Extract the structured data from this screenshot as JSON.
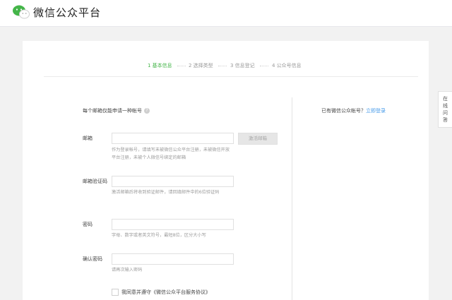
{
  "header": {
    "brand": "微信公众平台",
    "logo_icon": "wechat-logo-icon"
  },
  "steps": [
    {
      "label": "1 基本信息",
      "active": true
    },
    {
      "label": "2 选择类型",
      "active": false
    },
    {
      "label": "3 信息登记",
      "active": false
    },
    {
      "label": "4 公众号信息",
      "active": false
    }
  ],
  "form": {
    "notice": "每个邮箱仅能申请一种帐号",
    "email": {
      "label": "邮箱",
      "value": "",
      "hint": "作为登录帐号，请填写未被微信公众平台注册，未被微信开放平台注册，未被个人微信号绑定的邮箱",
      "activate_label": "激活邮箱"
    },
    "code": {
      "label": "邮箱验证码",
      "value": "",
      "hint": "激活邮箱后将收到验证邮件，请回填邮件中的6位验证码"
    },
    "password": {
      "label": "密码",
      "value": "",
      "hint": "字母、数字或者英文符号，最短8位，区分大小写"
    },
    "confirm": {
      "label": "确认密码",
      "value": "",
      "hint": "请再次输入密码"
    },
    "agreement": {
      "prefix": "我同意并遵守",
      "link": "《微信公众平台服务协议》",
      "checked": false
    }
  },
  "side": {
    "question": "已有微信公众帐号？",
    "login_link": "立即登录"
  },
  "side_tab": {
    "chars": [
      "在",
      "线",
      "问",
      "答"
    ]
  },
  "colors": {
    "accent_green": "#44b549",
    "link_blue": "#459ae9",
    "background": "#f2f2f2"
  }
}
